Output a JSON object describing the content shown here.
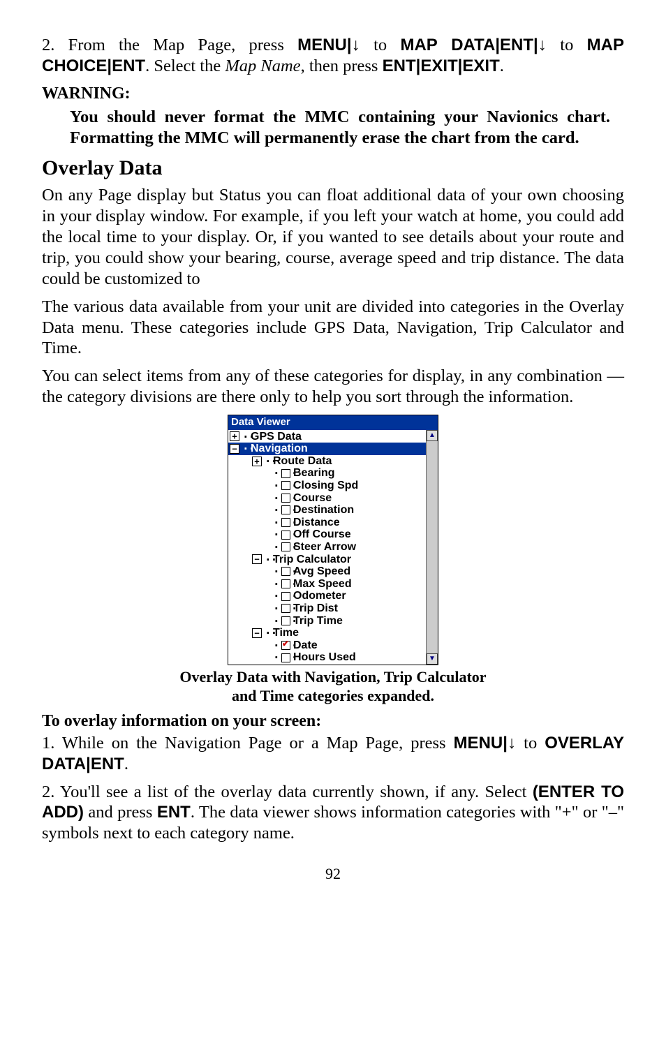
{
  "step2": {
    "prefix": "2. From the Map Page, press ",
    "menu": "MENU",
    "to1": " to ",
    "mapData": "MAP DATA",
    "ent": "ENT",
    "to2": " to ",
    "mapChoice": "MAP CHOICE",
    "selectText": ". Select the ",
    "mapName": "Map Name",
    "thenPress": ", then press ",
    "exit": "EXIT",
    "period": "."
  },
  "warning": {
    "head": "WARNING:",
    "body": "You should never format the MMC containing your Navionics chart. Formatting the MMC will permanently erase the chart from the card."
  },
  "overlay": {
    "heading": "Overlay Data",
    "p1": "On any Page display but Status you can float additional data of your own choosing in your display window. For example, if you left your watch at home, you could add the local time to your display. Or, if you wanted to see details about your route and trip, you could show your bearing, course, average speed and trip distance. The data could be customized to",
    "p2": "The various data available from your unit are divided into categories in the Overlay Data menu. These categories include GPS Data, Navigation, Trip Calculator and Time.",
    "p3": "You can select items from any of these categories for display, in any combination — the category divisions are there only to help you sort through the information."
  },
  "screenshot": {
    "title": "Data Viewer",
    "gpsData": "GPS Data",
    "navigation": "Navigation",
    "routeData": "Route Data",
    "items1": [
      "Bearing",
      "Closing Spd",
      "Course",
      "Destination",
      "Distance",
      "Off Course",
      "Steer Arrow"
    ],
    "tripCalc": "Trip Calculator",
    "items2": [
      "Avg Speed",
      "Max Speed",
      "Odometer",
      "Trip Dist",
      "Trip Time"
    ],
    "time": "Time",
    "date": "Date",
    "hoursUsed": "Hours Used",
    "up": "▲",
    "down": "▼"
  },
  "caption": {
    "line1": "Overlay Data with Navigation, Trip Calculator",
    "line2": "and Time categories expanded."
  },
  "subhead": "To overlay information on your screen:",
  "step1b": {
    "prefix": "1. While on the Navigation Page or a Map Page, press ",
    "menu": "MENU",
    "to": " to ",
    "overlayData": "OVERLAY DATA",
    "ent": "ENT",
    "period": "."
  },
  "step2b": {
    "prefix": "2. You'll see a list of the overlay data currently shown, if any. Select ",
    "enterToAdd": "(ENTER TO ADD)",
    "mid1": " and press ",
    "ent": "ENT",
    "tail": ". The data viewer shows information categories with \"+\" or \"–\" symbols next to each category name."
  },
  "pageNumber": "92",
  "glyphs": {
    "pipe": "|",
    "down": "↓",
    "plus": "+",
    "minus": "−"
  }
}
